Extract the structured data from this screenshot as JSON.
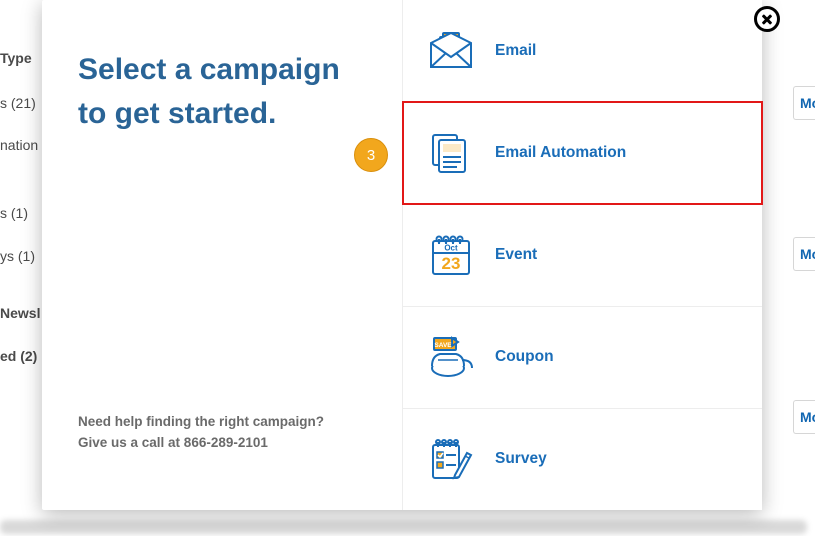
{
  "background": {
    "sidebar": {
      "plus": "+",
      "type_heading": "Type",
      "items": [
        "s (21)",
        "nation",
        "s (1)",
        "ys (1)",
        "Newsl",
        "ed (2)"
      ]
    },
    "buttons": {
      "mo": "Mo"
    }
  },
  "modal": {
    "title_line1": "Select a campaign",
    "title_line2": "to get started.",
    "help_line1": "Need help finding the right campaign?",
    "help_line2": "Give us a call at 866-289-2101",
    "options": [
      {
        "label": "Email"
      },
      {
        "label": "Email Automation"
      },
      {
        "label": "Event"
      },
      {
        "label": "Coupon"
      },
      {
        "label": "Survey"
      }
    ],
    "event_icon": {
      "month": "Oct",
      "day": "23"
    },
    "coupon_icon": {
      "tag": "SAVE"
    }
  },
  "step": "3"
}
